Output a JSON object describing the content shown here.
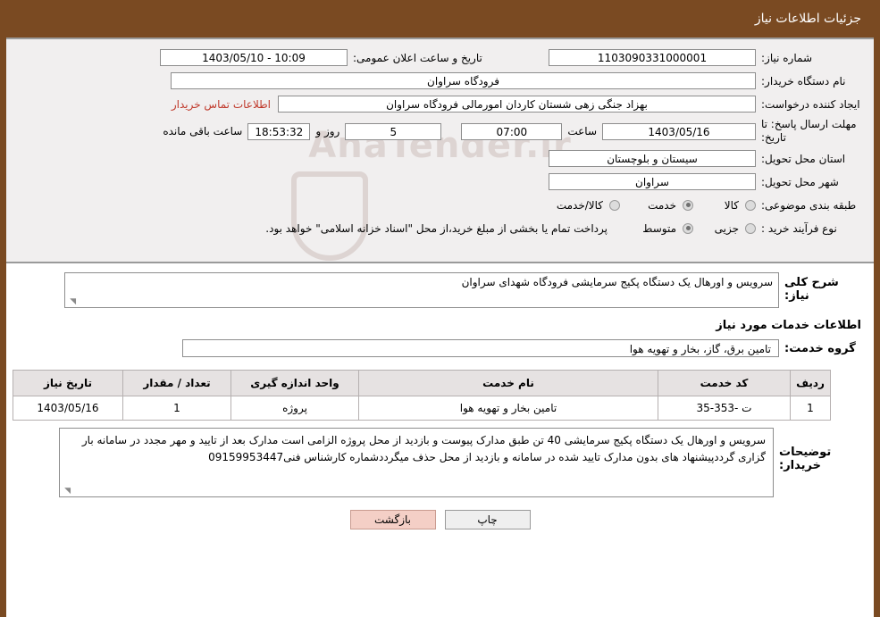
{
  "header": {
    "title": "جزئیات اطلاعات نیاز"
  },
  "watermark": {
    "text": "AnaTender.ir"
  },
  "info": {
    "need_number_label": "شماره نیاز:",
    "need_number_value": "1103090331000001",
    "announce_datetime_label": "تاریخ و ساعت اعلان عمومی:",
    "announce_datetime_value": "10:09 - 1403/05/10",
    "buyer_org_label": "نام دستگاه خریدار:",
    "buyer_org_value": "فرودگاه سراوان",
    "requester_label": "ایجاد کننده درخواست:",
    "requester_value": "بهزاد جنگی زهی شستان کاردان امورمالی فرودگاه سراوان",
    "contact_link": "اطلاعات تماس خریدار",
    "deadline_label": "مهلت ارسال پاسخ: تا تاریخ:",
    "deadline_date": "1403/05/16",
    "hour_label": "ساعت",
    "deadline_time": "07:00",
    "days_value": "5",
    "days_label": "روز و",
    "remaining_time": "18:53:32",
    "remaining_label": "ساعت باقی مانده",
    "province_label": "استان محل تحویل:",
    "province_value": "سیستان و بلوچستان",
    "city_label": "شهر محل تحویل:",
    "city_value": "سراوان",
    "category_label": "طبقه بندی موضوعی:",
    "category_options": [
      "کالا",
      "خدمت",
      "کالا/خدمت"
    ],
    "category_selected": "خدمت",
    "process_label": "نوع فرآیند خرید :",
    "process_options": [
      "جزیی",
      "متوسط"
    ],
    "process_selected": "متوسط",
    "process_note": "پرداخت تمام یا بخشی از مبلغ خرید،از محل \"اسناد خزانه اسلامی\" خواهد بود."
  },
  "need_summary": {
    "label": "شرح کلی نیاز:",
    "value": "سرویس و اورهال یک دستگاه پکیج سرمایشی فرودگاه شهدای سراوان"
  },
  "services_section": {
    "title": "اطلاعات خدمات مورد نیاز",
    "group_label": "گروه خدمت:",
    "group_value": "تامین برق، گاز، بخار و تهویه هوا"
  },
  "table": {
    "columns": [
      "ردیف",
      "کد خدمت",
      "نام خدمت",
      "واحد اندازه گیری",
      "تعداد / مقدار",
      "تاریخ نیاز"
    ],
    "rows": [
      [
        "1",
        "ت -353-35",
        "تامین بخار و تهویه هوا",
        "پروژه",
        "1",
        "1403/05/16"
      ]
    ]
  },
  "remarks": {
    "label": "توضیحات خریدار:",
    "value": "سرویس و اورهال یک دستگاه پکیج سرمایشی 40 تن طبق مدارک پیوست و بازدید از محل پروژه الزامی است مدارک بعد از تایید و مهر مجدد در سامانه بار گزاری گرددپیشنهاد های بدون مدارک تایید شده در سامانه و بازدید از محل حذف میگرددشماره کارشناس فنی09159953447"
  },
  "buttons": {
    "print": "چاپ",
    "back": "بازگشت"
  }
}
